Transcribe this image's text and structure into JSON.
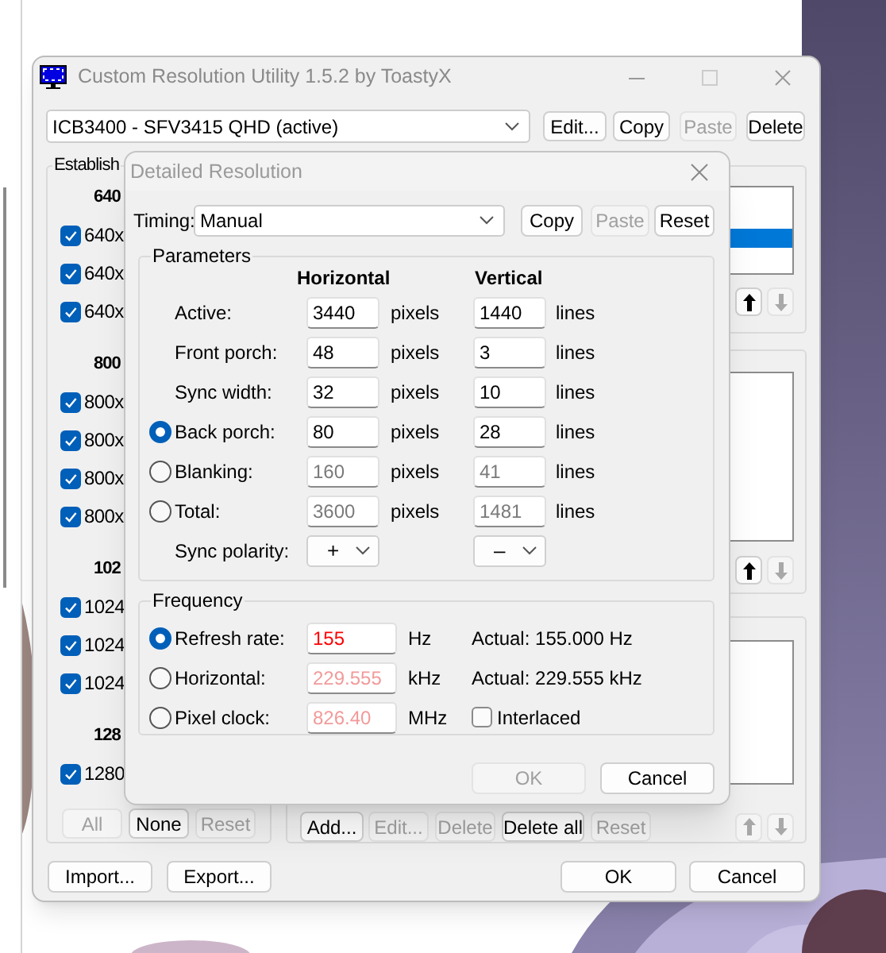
{
  "main_window": {
    "title": "Custom Resolution Utility 1.5.2 by ToastyX",
    "monitor": {
      "value": "ICB3400 - SFV3415 QHD (active)"
    },
    "monitor_buttons": [
      {
        "label": "Edit...",
        "disabled": false
      },
      {
        "label": "Copy",
        "disabled": false
      },
      {
        "label": "Paste",
        "disabled": true
      },
      {
        "label": "Delete",
        "disabled": false
      }
    ],
    "established": {
      "title": "Establish",
      "groups": [
        {
          "header": "640",
          "items": [
            {
              "label": "640x",
              "checked": true
            },
            {
              "label": "640x",
              "checked": true
            },
            {
              "label": "640x",
              "checked": true
            }
          ]
        },
        {
          "header": "800",
          "items": [
            {
              "label": "800x",
              "checked": true
            },
            {
              "label": "800x",
              "checked": true
            },
            {
              "label": "800x",
              "checked": true
            },
            {
              "label": "800x",
              "checked": true
            }
          ]
        },
        {
          "header": "102",
          "items": [
            {
              "label": "1024",
              "checked": true
            },
            {
              "label": "1024",
              "checked": true
            },
            {
              "label": "1024",
              "checked": true
            }
          ]
        },
        {
          "header": "128",
          "items": [
            {
              "label": "1280",
              "checked": true
            }
          ]
        }
      ],
      "buttons": [
        {
          "label": "All",
          "disabled": true
        },
        {
          "label": "None",
          "disabled": false
        },
        {
          "label": "Reset",
          "disabled": true
        }
      ]
    },
    "lists": [
      {
        "rows": [
          {
            "selected": false
          },
          {
            "selected": true
          }
        ],
        "up_disabled": false,
        "down_disabled": true
      },
      {
        "up_disabled": false,
        "down_disabled": true
      },
      {
        "up_disabled": true,
        "down_disabled": true
      }
    ],
    "list_buttons": [
      {
        "label": "Add...",
        "disabled": false
      },
      {
        "label": "Edit...",
        "disabled": true
      },
      {
        "label": "Delete",
        "disabled": true
      },
      {
        "label": "Delete all",
        "disabled": false
      },
      {
        "label": "Reset",
        "disabled": true
      }
    ],
    "footer_left": [
      {
        "label": "Import...",
        "disabled": false
      },
      {
        "label": "Export...",
        "disabled": false
      }
    ],
    "footer_right": [
      {
        "label": "OK",
        "disabled": false
      },
      {
        "label": "Cancel",
        "disabled": false
      }
    ]
  },
  "dialog": {
    "title": "Detailed Resolution",
    "timing": {
      "label": "Timing:",
      "value": "Manual"
    },
    "timing_buttons": [
      {
        "label": "Copy",
        "disabled": false
      },
      {
        "label": "Paste",
        "disabled": true
      },
      {
        "label": "Reset",
        "disabled": false
      }
    ],
    "parameters": {
      "title": "Parameters",
      "columns": [
        "Horizontal",
        "Vertical"
      ],
      "rows": [
        {
          "kind": "field",
          "label": "Active:",
          "horizontal": "3440",
          "h_unit": "pixels",
          "vertical": "1440",
          "v_unit": "lines",
          "disabled": false
        },
        {
          "kind": "field",
          "label": "Front porch:",
          "horizontal": "48",
          "h_unit": "pixels",
          "vertical": "3",
          "v_unit": "lines",
          "disabled": false
        },
        {
          "kind": "field",
          "label": "Sync width:",
          "horizontal": "32",
          "h_unit": "pixels",
          "vertical": "10",
          "v_unit": "lines",
          "disabled": false
        },
        {
          "kind": "radio",
          "selected": true,
          "label": "Back porch:",
          "horizontal": "80",
          "h_unit": "pixels",
          "vertical": "28",
          "v_unit": "lines",
          "disabled": false
        },
        {
          "kind": "radio",
          "selected": false,
          "label": "Blanking:",
          "horizontal": "160",
          "h_unit": "pixels",
          "vertical": "41",
          "v_unit": "lines",
          "disabled": true
        },
        {
          "kind": "radio",
          "selected": false,
          "label": "Total:",
          "horizontal": "3600",
          "h_unit": "pixels",
          "vertical": "1481",
          "v_unit": "lines",
          "disabled": true
        },
        {
          "kind": "select",
          "label": "Sync polarity:",
          "horizontal": "+",
          "vertical": "–"
        }
      ]
    },
    "frequency": {
      "title": "Frequency",
      "rows": [
        {
          "label": "Refresh rate:",
          "selected": true,
          "value": "155",
          "unit": "Hz",
          "disabled": false,
          "invalid": true,
          "actual": "Actual: 155.000 Hz"
        },
        {
          "label": "Horizontal:",
          "selected": false,
          "value": "229.555",
          "unit": "kHz",
          "disabled": true,
          "invalid": true,
          "actual": "Actual: 229.555 kHz"
        },
        {
          "label": "Pixel clock:",
          "selected": false,
          "value": "826.40",
          "unit": "MHz",
          "disabled": true,
          "invalid": true,
          "interlaced": {
            "label": "Interlaced",
            "checked": false
          }
        }
      ]
    },
    "buttons": [
      {
        "label": "OK",
        "disabled": true
      },
      {
        "label": "Cancel",
        "disabled": false
      }
    ]
  }
}
